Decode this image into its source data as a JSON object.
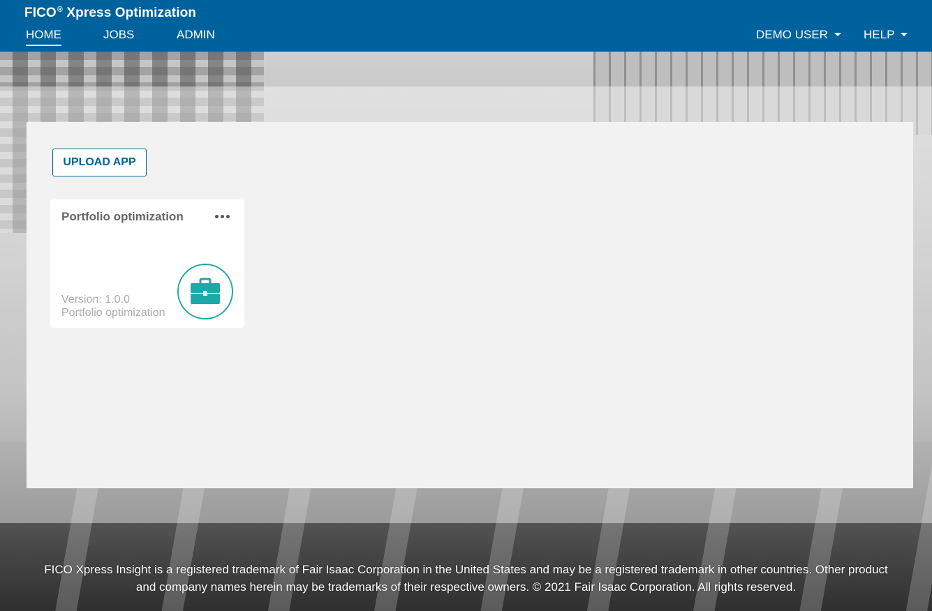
{
  "header": {
    "brand_prefix": "FICO",
    "brand_registered": "®",
    "brand_suffix": " Xpress Optimization",
    "nav": {
      "home": "HOME",
      "jobs": "JOBS",
      "admin": "ADMIN"
    },
    "user_menu": "DEMO USER",
    "help_menu": "HELP"
  },
  "main": {
    "upload_label": "UPLOAD APP",
    "apps": [
      {
        "name": "Portfolio optimization",
        "version": "Version: 1.0.0",
        "description": "Portfolio optimization",
        "icon": "briefcase-icon"
      }
    ]
  },
  "footer": {
    "line1": "FICO Xpress Insight is a registered trademark of Fair Isaac Corporation in the United States and may be a registered trademark in other countries. Other product",
    "line2": "and company names herein may be trademarks of their respective owners. © 2021 Fair Isaac Corporation. All rights reserved."
  },
  "colors": {
    "header_bg": "#00629c",
    "accent": "#00629c",
    "icon_teal": "#1ea9a9"
  }
}
